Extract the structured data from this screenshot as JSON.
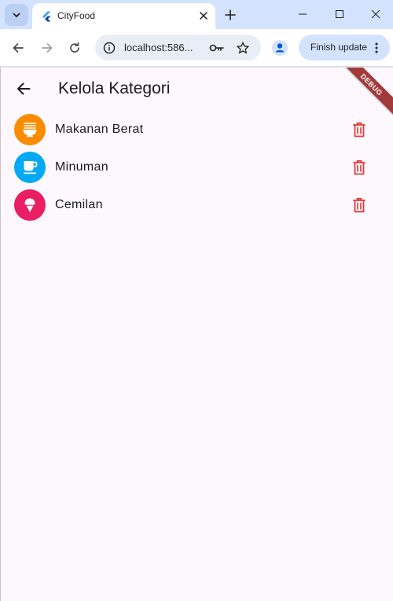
{
  "browser": {
    "tab_title": "CityFood",
    "url": "localhost:586...",
    "finish_update_label": "Finish update"
  },
  "app": {
    "title": "Kelola Kategori",
    "debug_banner": "DEBUG",
    "categories": [
      {
        "name": "Makanan Berat",
        "color": "#fb8c00",
        "icon": "ramen-dining-icon"
      },
      {
        "name": "Minuman",
        "color": "#03a9f4",
        "icon": "coffee-cup-icon"
      },
      {
        "name": "Cemilan",
        "color": "#e91e63",
        "icon": "ice-cream-icon"
      }
    ],
    "delete_color": "#e53935"
  }
}
